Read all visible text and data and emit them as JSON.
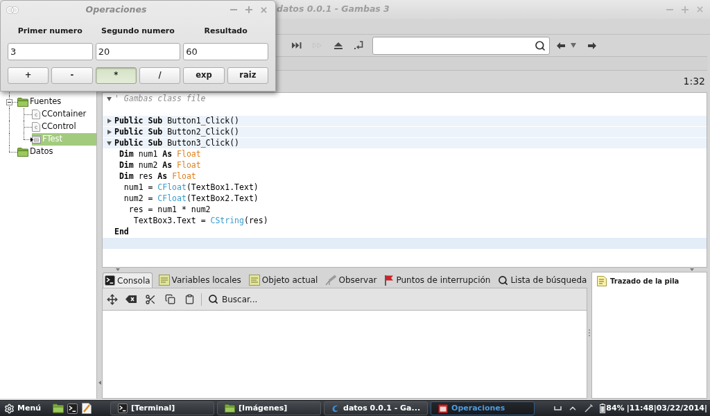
{
  "dialog": {
    "title": "Operaciones",
    "fields": [
      {
        "label": "Primer numero",
        "value": "3"
      },
      {
        "label": "Segundo numero",
        "value": "20"
      },
      {
        "label": "Resultado",
        "value": "60"
      }
    ],
    "buttons": [
      {
        "label": "+",
        "pressed": false
      },
      {
        "label": "-",
        "pressed": false
      },
      {
        "label": "*",
        "pressed": true
      },
      {
        "label": "/",
        "pressed": false
      },
      {
        "label": "exp",
        "pressed": false
      },
      {
        "label": "raiz",
        "pressed": false
      }
    ]
  },
  "window": {
    "title": "datos 0.0.1 - Gambas 3"
  },
  "toolbar": {
    "buttons": [
      {
        "kind": "skip",
        "disabled": false
      },
      {
        "kind": "step",
        "disabled": true
      },
      {
        "kind": "eject",
        "disabled": false
      },
      {
        "kind": "return",
        "disabled": false
      }
    ]
  },
  "project_tree": [
    {
      "kind": "folder",
      "label": "Fuentes",
      "expanded": true,
      "selected": false,
      "children": [
        {
          "kind": "class",
          "label": "CContainer",
          "selected": false
        },
        {
          "kind": "class",
          "label": "CControl",
          "selected": false
        },
        {
          "kind": "form",
          "label": "FTest",
          "selected": true
        }
      ]
    },
    {
      "kind": "folder",
      "label": "Datos",
      "selected": false
    }
  ],
  "editor": {
    "position": "1:32",
    "lines": [
      {
        "kind": "code",
        "current": false,
        "collapsed": false,
        "tokens": [
          {
            "kind": "comment",
            "text": "' Gambas class file"
          }
        ]
      },
      {
        "kind": "code",
        "current": false
      },
      {
        "kind": "procedure",
        "current": false,
        "collapsed": true,
        "tokens": [
          {
            "kind": "keyword",
            "text": "Public Sub"
          },
          {
            "kind": "plain",
            "text": " Button1_Click()"
          }
        ]
      },
      {
        "kind": "procedure",
        "current": false,
        "collapsed": true,
        "tokens": [
          {
            "kind": "keyword",
            "text": "Public Sub"
          },
          {
            "kind": "plain",
            "text": " Button2_Click()"
          }
        ]
      },
      {
        "kind": "procedure",
        "current": false,
        "collapsed": false,
        "tokens": [
          {
            "kind": "keyword",
            "text": "Public Sub"
          },
          {
            "kind": "plain",
            "text": " Button3_Click()"
          }
        ]
      },
      {
        "kind": "code",
        "current": false,
        "tokens": [
          {
            "kind": "keyword",
            "text": " Dim"
          },
          {
            "kind": "plain",
            "text": " num1 "
          },
          {
            "kind": "keyword",
            "text": "As"
          },
          {
            "kind": "type",
            "text": " Float"
          }
        ]
      },
      {
        "kind": "code",
        "current": false,
        "tokens": [
          {
            "kind": "keyword",
            "text": " Dim"
          },
          {
            "kind": "plain",
            "text": " num2 "
          },
          {
            "kind": "keyword",
            "text": "As"
          },
          {
            "kind": "type",
            "text": " Float"
          }
        ]
      },
      {
        "kind": "code",
        "current": false,
        "tokens": [
          {
            "kind": "keyword",
            "text": " Dim"
          },
          {
            "kind": "plain",
            "text": " res "
          },
          {
            "kind": "keyword",
            "text": "As"
          },
          {
            "kind": "type",
            "text": " Float"
          }
        ]
      },
      {
        "kind": "code",
        "current": false,
        "tokens": [
          {
            "kind": "plain",
            "text": "  num1 = "
          },
          {
            "kind": "function",
            "text": "CFloat"
          },
          {
            "kind": "plain",
            "text": "(TextBox1.Text)"
          }
        ]
      },
      {
        "kind": "code",
        "current": false,
        "tokens": [
          {
            "kind": "plain",
            "text": "  num2 = "
          },
          {
            "kind": "function",
            "text": "CFloat"
          },
          {
            "kind": "plain",
            "text": "(TextBox2.Text)"
          }
        ]
      },
      {
        "kind": "code",
        "current": false,
        "tokens": [
          {
            "kind": "plain",
            "text": "   res = num1 * num2"
          }
        ]
      },
      {
        "kind": "code",
        "current": false,
        "tokens": [
          {
            "kind": "plain",
            "text": "    TextBox3.Text = "
          },
          {
            "kind": "function",
            "text": "CString"
          },
          {
            "kind": "plain",
            "text": "(res)"
          }
        ]
      },
      {
        "kind": "code",
        "current": false,
        "tokens": [
          {
            "kind": "keyword",
            "text": "End"
          }
        ]
      },
      {
        "kind": "code",
        "current": true
      }
    ]
  },
  "debug_panel": {
    "tabs": [
      {
        "kind": "console",
        "label": "Consola",
        "selected": true
      },
      {
        "kind": "variables",
        "label": "Variables locales",
        "selected": false
      },
      {
        "kind": "object",
        "label": "Objeto actual",
        "selected": false
      },
      {
        "kind": "watch",
        "label": "Observar",
        "selected": false
      },
      {
        "kind": "breakpoints",
        "label": "Puntos de interrupción",
        "selected": false
      },
      {
        "kind": "search",
        "label": "Lista de búsqueda",
        "selected": false
      }
    ],
    "search_button": "Buscar...",
    "stack_title": "Trazado de la pila"
  },
  "taskbar": {
    "menu": "Menú",
    "tasks": [
      {
        "kind": "terminal",
        "label": "[Terminal]",
        "selected": false
      },
      {
        "kind": "folder",
        "label": "[Imágenes]",
        "selected": false
      },
      {
        "kind": "gambas",
        "label": "datos 0.0.1 - Ga...",
        "selected": false
      },
      {
        "kind": "dialog",
        "label": "Operaciones",
        "selected": true
      }
    ],
    "battery": "84%",
    "clock": "|11:48|03/22/2014|"
  }
}
